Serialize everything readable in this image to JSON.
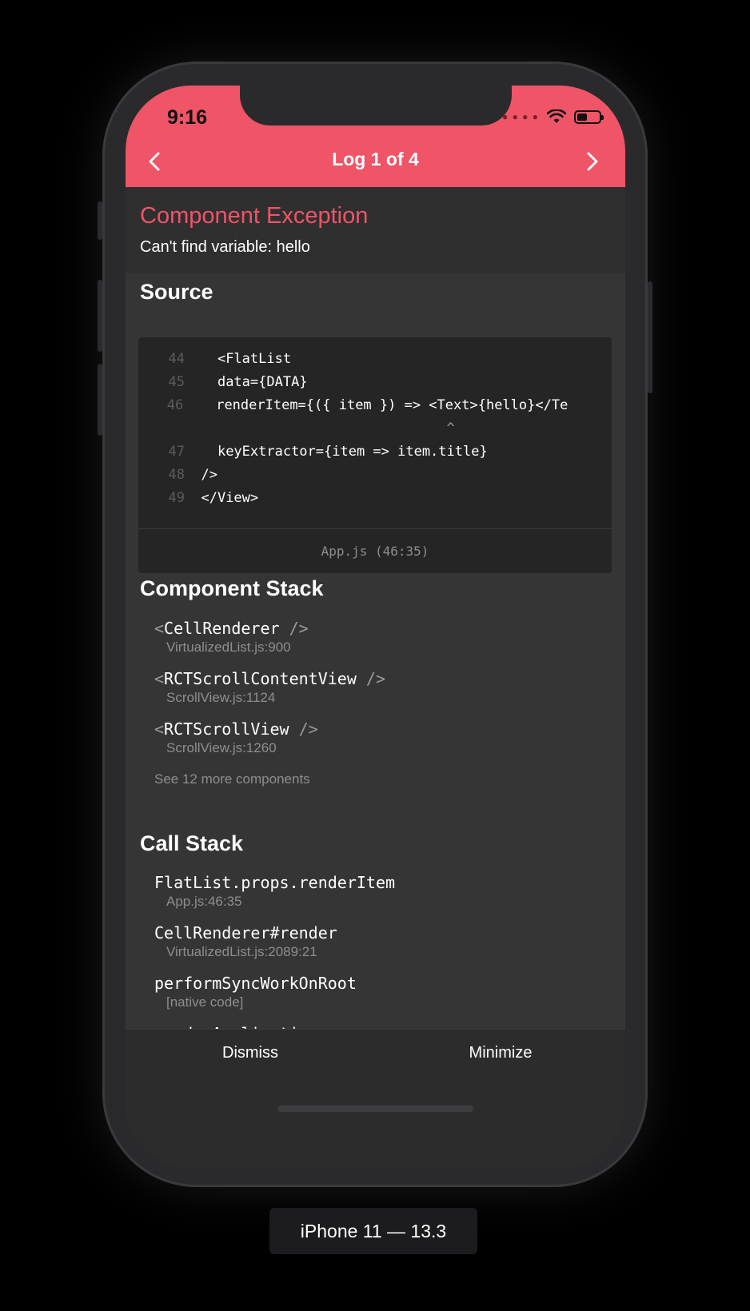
{
  "status_bar": {
    "time": "9:16"
  },
  "nav": {
    "title": "Log 1 of 4",
    "prev_icon": "chevron-left-icon",
    "next_icon": "chevron-right-icon"
  },
  "exception": {
    "title": "Component Exception",
    "message": "Can't find variable: hello"
  },
  "source": {
    "heading": "Source",
    "lines": [
      {
        "num": "44",
        "marker": "",
        "code": "  <FlatList"
      },
      {
        "num": "45",
        "marker": "",
        "code": "  data={DATA}"
      },
      {
        "num": "46",
        "marker": ">",
        "code": "  renderItem={({ item }) => <Text>{hello}</Te"
      },
      {
        "num": "",
        "marker": "",
        "code": "                              ^"
      },
      {
        "num": "47",
        "marker": "",
        "code": "  keyExtractor={item => item.title}"
      },
      {
        "num": "48",
        "marker": "",
        "code": "/>"
      },
      {
        "num": "49",
        "marker": "",
        "code": "</View>"
      }
    ],
    "file_location": "App.js (46:35)"
  },
  "component_stack": {
    "heading": "Component Stack",
    "frames": [
      {
        "name": "CellRenderer",
        "location": "VirtualizedList.js:900"
      },
      {
        "name": "RCTScrollContentView",
        "location": "ScrollView.js:1124"
      },
      {
        "name": "RCTScrollView",
        "location": "ScrollView.js:1260"
      }
    ],
    "see_more": "See 12 more components"
  },
  "call_stack": {
    "heading": "Call Stack",
    "frames": [
      {
        "name": "FlatList.props.renderItem",
        "location": "App.js:46:35"
      },
      {
        "name": "CellRenderer#render",
        "location": "VirtualizedList.js:2089:21"
      },
      {
        "name": "performSyncWorkOnRoot",
        "location": "[native code]"
      },
      {
        "name": "renderApplication",
        "location": ""
      }
    ]
  },
  "footer": {
    "dismiss": "Dismiss",
    "minimize": "Minimize"
  },
  "device_label": "iPhone 11 — 13.3",
  "colors": {
    "accent": "#ef5467",
    "background": "#353536",
    "footer": "#2c2c2d"
  }
}
